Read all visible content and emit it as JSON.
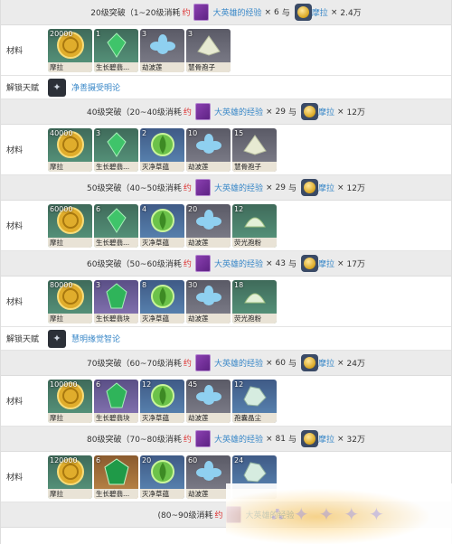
{
  "labels": {
    "materials": "材料",
    "unlock_talent": "解锁天赋",
    "yue": "约",
    "exp_name": "大英雄的经验",
    "times": "×",
    "and": "与",
    "mora": "摩拉"
  },
  "sections": [
    {
      "header": "20级突破（1~20级消耗",
      "exp_count": "6",
      "mora_amount": "2.4万",
      "items": [
        {
          "count": "20000",
          "name": "摩拉",
          "type": "mora"
        },
        {
          "count": "1",
          "name": "生长碧翡...",
          "type": "gem"
        },
        {
          "count": "3",
          "name": "劫波莲",
          "type": "lotus"
        },
        {
          "count": "3",
          "name": "慧骨孢子",
          "type": "spore"
        }
      ],
      "talent": "净善摄受明论"
    },
    {
      "header": "40级突破（20~40级消耗",
      "exp_count": "29",
      "mora_amount": "12万",
      "items": [
        {
          "count": "40000",
          "name": "摩拉",
          "type": "mora"
        },
        {
          "count": "3",
          "name": "生长碧翡...",
          "type": "gem"
        },
        {
          "count": "2",
          "name": "灭净草蕴",
          "type": "seed"
        },
        {
          "count": "10",
          "name": "劫波莲",
          "type": "lotus"
        },
        {
          "count": "15",
          "name": "慧骨孢子",
          "type": "spore"
        }
      ]
    },
    {
      "header": "50级突破（40~50级消耗",
      "exp_count": "29",
      "mora_amount": "12万",
      "items": [
        {
          "count": "60000",
          "name": "摩拉",
          "type": "mora"
        },
        {
          "count": "6",
          "name": "生长碧翡...",
          "type": "gem"
        },
        {
          "count": "4",
          "name": "灭净草蕴",
          "type": "seed"
        },
        {
          "count": "20",
          "name": "劫波莲",
          "type": "lotus"
        },
        {
          "count": "12",
          "name": "荧光孢粉",
          "type": "powder"
        }
      ]
    },
    {
      "header": "60级突破（50~60级消耗",
      "exp_count": "43",
      "mora_amount": "17万",
      "items": [
        {
          "count": "80000",
          "name": "摩拉",
          "type": "mora"
        },
        {
          "count": "3",
          "name": "生长碧翡块",
          "type": "gem4"
        },
        {
          "count": "8",
          "name": "灭净草蕴",
          "type": "seed"
        },
        {
          "count": "30",
          "name": "劫波莲",
          "type": "lotus"
        },
        {
          "count": "18",
          "name": "荧光孢粉",
          "type": "powder"
        }
      ],
      "talent": "慧明缘觉智论"
    },
    {
      "header": "70级突破（60~70级消耗",
      "exp_count": "60",
      "mora_amount": "24万",
      "items": [
        {
          "count": "100000",
          "name": "摩拉",
          "type": "mora"
        },
        {
          "count": "6",
          "name": "生长碧翡块",
          "type": "gem4"
        },
        {
          "count": "12",
          "name": "灭净草蕴",
          "type": "seed"
        },
        {
          "count": "45",
          "name": "劫波莲",
          "type": "lotus"
        },
        {
          "count": "12",
          "name": "孢囊晶尘",
          "type": "crystal"
        }
      ]
    },
    {
      "header": "80级突破（70~80级消耗",
      "exp_count": "81",
      "mora_amount": "32万",
      "items": [
        {
          "count": "120000",
          "name": "摩拉",
          "type": "mora"
        },
        {
          "count": "6",
          "name": "生长碧翡...",
          "type": "gem5"
        },
        {
          "count": "20",
          "name": "灭净草蕴",
          "type": "seed"
        },
        {
          "count": "60",
          "name": "劫波莲",
          "type": "lotus"
        },
        {
          "count": "24",
          "name": "",
          "type": "crystal"
        }
      ]
    },
    {
      "header": "(80~90级消耗",
      "exp_count": "",
      "mora_amount": ""
    }
  ]
}
